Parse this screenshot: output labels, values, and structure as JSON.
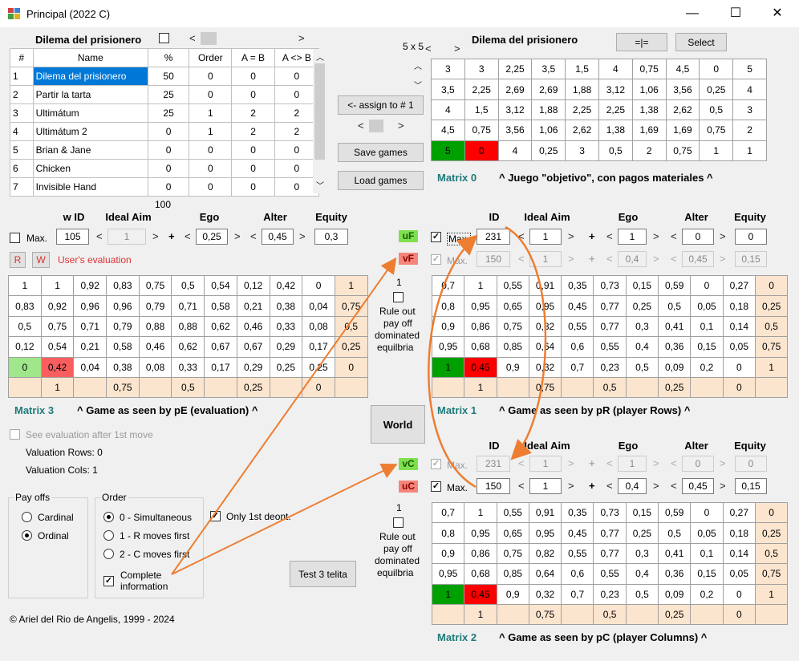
{
  "window": {
    "title": "Principal (2022 C)",
    "minimize": "—",
    "maximize": "☐",
    "close": "✕"
  },
  "games": {
    "title": "Dilema del prisionero",
    "headers": [
      "#",
      "Name",
      "%",
      "Order",
      "A = B",
      "A <> B"
    ],
    "rows": [
      [
        "1",
        "Dilema del prisionero",
        "50",
        "0",
        "0",
        "0"
      ],
      [
        "2",
        "Partir la tarta",
        "25",
        "0",
        "0",
        "0"
      ],
      [
        "3",
        "Ultimátum",
        "25",
        "1",
        "2",
        "2"
      ],
      [
        "4",
        "Ultimátum 2",
        "0",
        "1",
        "2",
        "2"
      ],
      [
        "5",
        "Brian & Jane",
        "0",
        "0",
        "0",
        "0"
      ],
      [
        "6",
        "Chicken",
        "0",
        "0",
        "0",
        "0"
      ],
      [
        "7",
        "Invisible Hand",
        "0",
        "0",
        "0",
        "0"
      ]
    ],
    "total": "100"
  },
  "middle": {
    "assign": "<- assign to # 1",
    "save": "Save games",
    "load": "Load games",
    "world": "World",
    "test": "Test 3 telita",
    "dim": "5 x 5"
  },
  "top": {
    "title": "Dilema del prisionero",
    "btn_eq": "=|=",
    "btn_select": "Select",
    "caption": "^ Juego \"objetivo\", con pagos materiales ^",
    "label": "Matrix 0",
    "rows": [
      [
        "3",
        "3",
        "2,25",
        "3,5",
        "1,5",
        "4",
        "0,75",
        "4,5",
        "0",
        "5"
      ],
      [
        "3,5",
        "2,25",
        "2,69",
        "2,69",
        "1,88",
        "3,12",
        "1,06",
        "3,56",
        "0,25",
        "4"
      ],
      [
        "4",
        "1,5",
        "3,12",
        "1,88",
        "2,25",
        "2,25",
        "1,38",
        "2,62",
        "0,5",
        "3"
      ],
      [
        "4,5",
        "0,75",
        "3,56",
        "1,06",
        "2,62",
        "1,38",
        "1,69",
        "1,69",
        "0,75",
        "2"
      ],
      [
        "5",
        "0",
        "4",
        "0,25",
        "3",
        "0,5",
        "2",
        "0,75",
        "1",
        "1"
      ]
    ]
  },
  "params": {
    "hid": "ID",
    "hwid": "w ID",
    "ideal": "Ideal Aim",
    "ego": "Ego",
    "alter": "Alter",
    "equity": "Equity",
    "max": "Max.",
    "plus": "+",
    "left": "<",
    "right": ">"
  },
  "left": {
    "wid": "105",
    "aim": "1",
    "ego": "0,25",
    "alter": "0,45",
    "equity": "0,3",
    "r": "R",
    "w": "W",
    "users": "User's evaluation",
    "label": "Matrix 3",
    "caption": "^ Game as seen by pE (evaluation) ^",
    "rows": [
      [
        "1",
        "1",
        "0,92",
        "0,83",
        "0,75",
        "0,5",
        "0,54",
        "0,12",
        "0,42",
        "0",
        "1"
      ],
      [
        "0,83",
        "0,92",
        "0,96",
        "0,96",
        "0,79",
        "0,71",
        "0,58",
        "0,21",
        "0,38",
        "0,04",
        "0,75"
      ],
      [
        "0,5",
        "0,75",
        "0,71",
        "0,79",
        "0,88",
        "0,88",
        "0,62",
        "0,46",
        "0,33",
        "0,08",
        "0,5"
      ],
      [
        "0,12",
        "0,54",
        "0,21",
        "0,58",
        "0,46",
        "0,62",
        "0,67",
        "0,67",
        "0,29",
        "0,17",
        "0,25"
      ],
      [
        "0",
        "0,42",
        "0,04",
        "0,38",
        "0,08",
        "0,33",
        "0,17",
        "0,29",
        "0,25",
        "0,25",
        "0"
      ]
    ],
    "foot": [
      "",
      "1",
      "",
      "0,75",
      "",
      "0,5",
      "",
      "0,25",
      "",
      "0",
      ""
    ]
  },
  "r": {
    "uf": "uF",
    "vf": "vF",
    "id": "231",
    "aim": "1",
    "ego": "1",
    "alter": "0",
    "equity": "0",
    "vid": "150",
    "vaim": "1",
    "vego": "0,4",
    "valter": "0,45",
    "vequity": "0,15",
    "label": "Matrix 1",
    "caption": "^ Game as seen by pR (player Rows) ^"
  },
  "c": {
    "vc": "vC",
    "uc": "uC",
    "vid": "231",
    "vaim": "1",
    "vego": "1",
    "valter": "0",
    "vequity": "0",
    "id": "150",
    "aim": "1",
    "ego": "0,4",
    "alter": "0,45",
    "equity": "0,15",
    "label": "Matrix 2",
    "caption": "^ Game as seen by pC (player Columns) ^"
  },
  "pmatrix": {
    "rows": [
      [
        "0,7",
        "1",
        "0,55",
        "0,91",
        "0,35",
        "0,73",
        "0,15",
        "0,59",
        "0",
        "0,27",
        "0"
      ],
      [
        "0,8",
        "0,95",
        "0,65",
        "0,95",
        "0,45",
        "0,77",
        "0,25",
        "0,5",
        "0,05",
        "0,18",
        "0,25"
      ],
      [
        "0,9",
        "0,86",
        "0,75",
        "0,82",
        "0,55",
        "0,77",
        "0,3",
        "0,41",
        "0,1",
        "0,14",
        "0,5"
      ],
      [
        "0,95",
        "0,68",
        "0,85",
        "0,64",
        "0,6",
        "0,55",
        "0,4",
        "0,36",
        "0,15",
        "0,05",
        "0,75"
      ],
      [
        "1",
        "0,45",
        "0,9",
        "0,32",
        "0,7",
        "0,23",
        "0,5",
        "0,09",
        "0,2",
        "0",
        "1"
      ]
    ],
    "foot": [
      "",
      "1",
      "",
      "0,75",
      "",
      "0,5",
      "",
      "0,25",
      "",
      "0",
      ""
    ]
  },
  "ruleout": {
    "num": "1",
    "text1": "Rule out",
    "text2": "pay off",
    "text3": "dominated",
    "text4": "equilbria"
  },
  "options": {
    "see_eval": "See evaluation after 1st move",
    "val_rows": "Valuation Rows: 0",
    "val_cols": "Valuation Cols: 1",
    "payoffs": "Pay offs",
    "cardinal": "Cardinal",
    "ordinal": "Ordinal",
    "order": "Order",
    "o0": "0 - Simultaneous",
    "o1": "1 - R moves first",
    "o2": "2 - C moves first",
    "complete1": "Complete",
    "complete2": "information",
    "only1st": "Only 1st deont.",
    "copyright": "© Ariel del Rio de Angelis, 1999 - 2024"
  },
  "colors": {
    "accent": "#1f7a7a",
    "orange": "#ed7d31",
    "green": "#00a000",
    "red": "#ff0000",
    "peach": "#fbe5cf"
  }
}
